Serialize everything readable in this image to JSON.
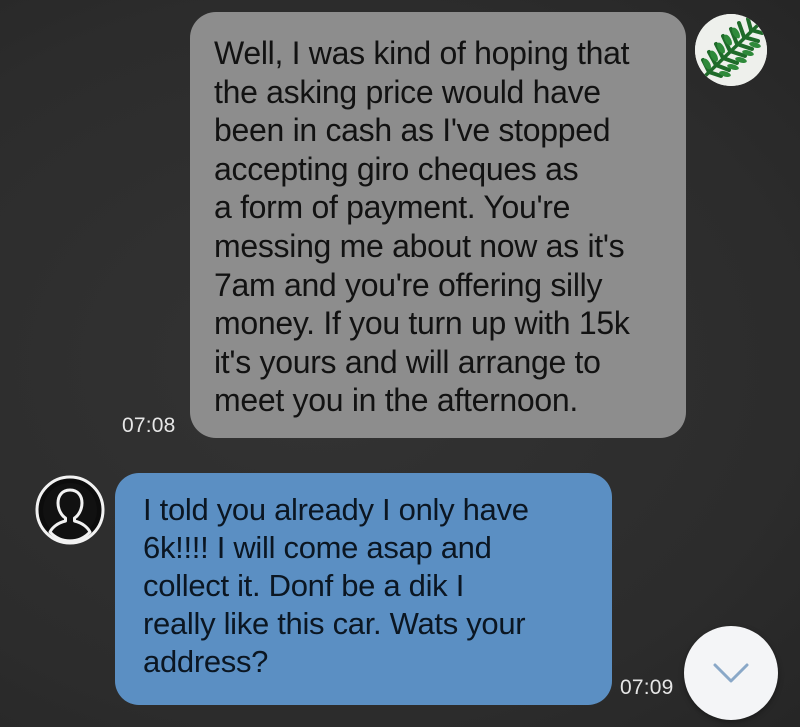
{
  "messages": [
    {
      "direction": "outgoing",
      "text": "Well, I was kind of hoping that\nthe asking price would have\nbeen in cash as I've stopped\naccepting giro cheques as\na form of payment. You're\nmessing me about now as it's\n7am and you're offering silly\nmoney. If you turn up with 15k\nit's yours and will arrange to\nmeet you in the afternoon.",
      "time": "07:08",
      "avatar_icon": "fern-leaf-avatar-icon"
    },
    {
      "direction": "incoming",
      "text": "I told you already I only have\n6k!!!! I will come asap and\ncollect it. Donf be a dik I\nreally like this car. Wats your\naddress?",
      "time": "07:09",
      "avatar_icon": "user-silhouette-icon"
    }
  ],
  "controls": {
    "scroll_down_icon": "chevron-down-icon"
  },
  "colors": {
    "background": "#2f2f2f",
    "outgoing_bubble": "#8d8d8d",
    "incoming_bubble": "#5b8fc3",
    "timestamp": "#e6e6e6"
  }
}
